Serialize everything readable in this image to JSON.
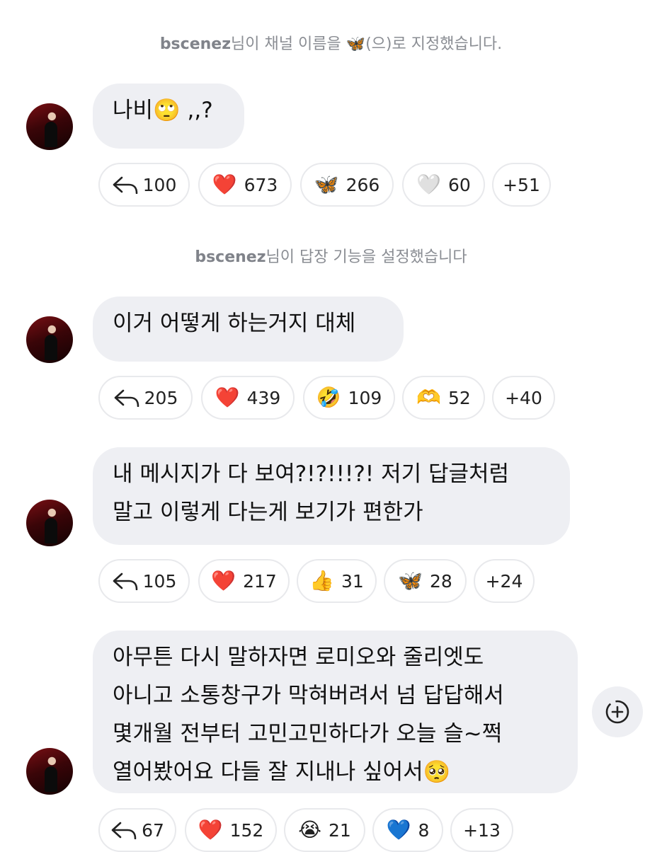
{
  "system_messages": [
    {
      "user": "bscenez",
      "pre": "님이 채널 이름을 ",
      "emoji": "🦋",
      "post": "(으)로 지정했습니다."
    },
    {
      "user": "bscenez",
      "text": "님이 답장 기능을 설정했습니다"
    }
  ],
  "messages": [
    {
      "lines": [
        "나비🙄 ,,?"
      ],
      "reactions": {
        "reply_count": "100",
        "chips": [
          {
            "emoji": "❤️",
            "count": "673"
          },
          {
            "emoji": "🦋",
            "count": "266"
          },
          {
            "emoji": "🤍",
            "count": "60"
          }
        ],
        "more": "+51"
      }
    },
    {
      "lines": [
        "이거 어떻게 하는거지 대체"
      ],
      "reactions": {
        "reply_count": "205",
        "chips": [
          {
            "emoji": "❤️",
            "count": "439"
          },
          {
            "emoji": "🤣",
            "count": "109"
          },
          {
            "emoji": "🫶",
            "count": "52"
          }
        ],
        "more": "+40"
      }
    },
    {
      "lines": [
        "내 메시지가 다 보여?!?!!!?! 저기 답글처럼",
        "말고 이렇게 다는게 보기가 편한가"
      ],
      "reactions": {
        "reply_count": "105",
        "chips": [
          {
            "emoji": "❤️",
            "count": "217"
          },
          {
            "emoji": "👍",
            "count": "31"
          },
          {
            "emoji": "🦋",
            "count": "28"
          }
        ],
        "more": "+24"
      }
    },
    {
      "lines": [
        "아무튼 다시 말하자면 로미오와 줄리엣도",
        "아니고 소통창구가 막혀버려서 넘 답답해서",
        "몇개월 전부터 고민고민하다가 오늘 슬~쩍",
        "열어봤어요 다들 잘 지내나 싶어서🥺"
      ],
      "reactions": {
        "reply_count": "67",
        "chips": [
          {
            "emoji": "❤️",
            "count": "152"
          },
          {
            "emoji": "😭",
            "count": "21"
          },
          {
            "emoji": "💙",
            "count": "8"
          }
        ],
        "more": "+13"
      }
    }
  ],
  "icons": {
    "reply": "reply-arrow-icon",
    "add_reaction": "add-reaction-icon",
    "avatar": "avatar"
  }
}
